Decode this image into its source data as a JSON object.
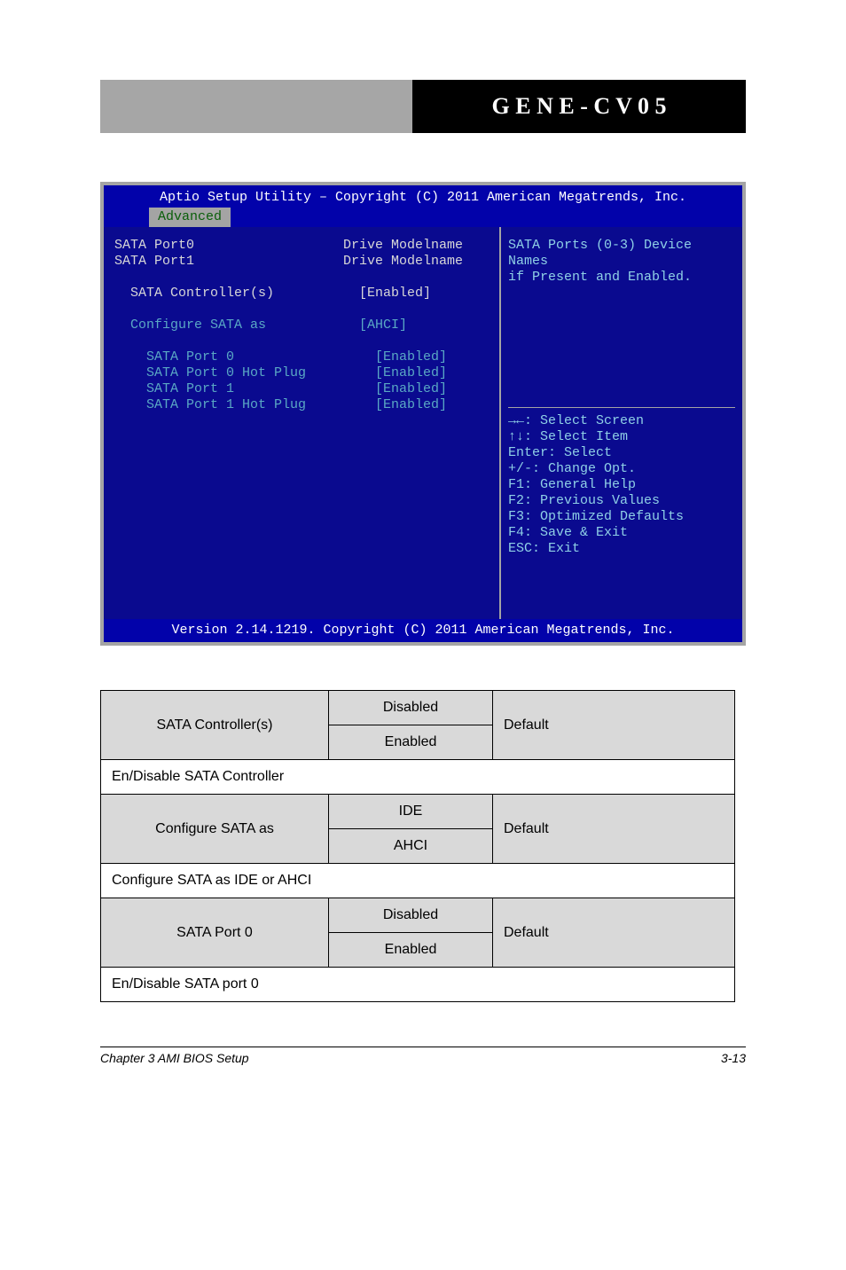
{
  "header": {
    "product": "G E N E - C V 0 5"
  },
  "bios": {
    "title": "Aptio Setup Utility – Copyright (C) 2011 American Megatrends, Inc.",
    "tab": "Advanced",
    "port0_label": "SATA Port0",
    "port0_val": "Drive Modelname",
    "port1_label": "SATA Port1",
    "port1_val": "Drive Modelname",
    "ctrl_label": "SATA Controller(s)",
    "ctrl_val": "[Enabled]",
    "conf_label": "Configure SATA as",
    "conf_val": "[AHCI]",
    "sp0_label": "SATA Port 0",
    "sp0_val": "[Enabled]",
    "hp0_label": "SATA Port 0 Hot Plug",
    "hp0_val": "[Enabled]",
    "sp1_label": "SATA Port 1",
    "sp1_val": "[Enabled]",
    "hp1_label": "SATA Port 1 Hot Plug",
    "hp1_val": "[Enabled]",
    "help1": "SATA Ports (0-3) Device Names",
    "help2": "if Present and Enabled.",
    "k1": "→←: Select Screen",
    "k2": "↑↓: Select Item",
    "k3": "Enter: Select",
    "k4": "+/-: Change Opt.",
    "k5": "F1: General Help",
    "k6": "F2: Previous Values",
    "k7": "F3: Optimized Defaults",
    "k8": "F4: Save & Exit",
    "k9": "ESC: Exit",
    "footer": "Version 2.14.1219. Copyright (C) 2011 American Megatrends, Inc."
  },
  "table": {
    "r1": {
      "name": "SATA Controller(s)",
      "o1": "Disabled",
      "o2": "Enabled",
      "default": "Default",
      "note": "En/Disable SATA Controller"
    },
    "r2": {
      "name": "Configure SATA as",
      "o1": "IDE",
      "o2": "AHCI",
      "default": "Default",
      "note": "Configure SATA as IDE or AHCI"
    },
    "r3": {
      "name": "SATA Port 0",
      "o1": "Disabled",
      "o2": "Enabled",
      "default": "Default",
      "note": "En/Disable SATA port 0"
    }
  },
  "footer": {
    "left": "Chapter 3 AMI BIOS Setup",
    "right": "3-13"
  }
}
